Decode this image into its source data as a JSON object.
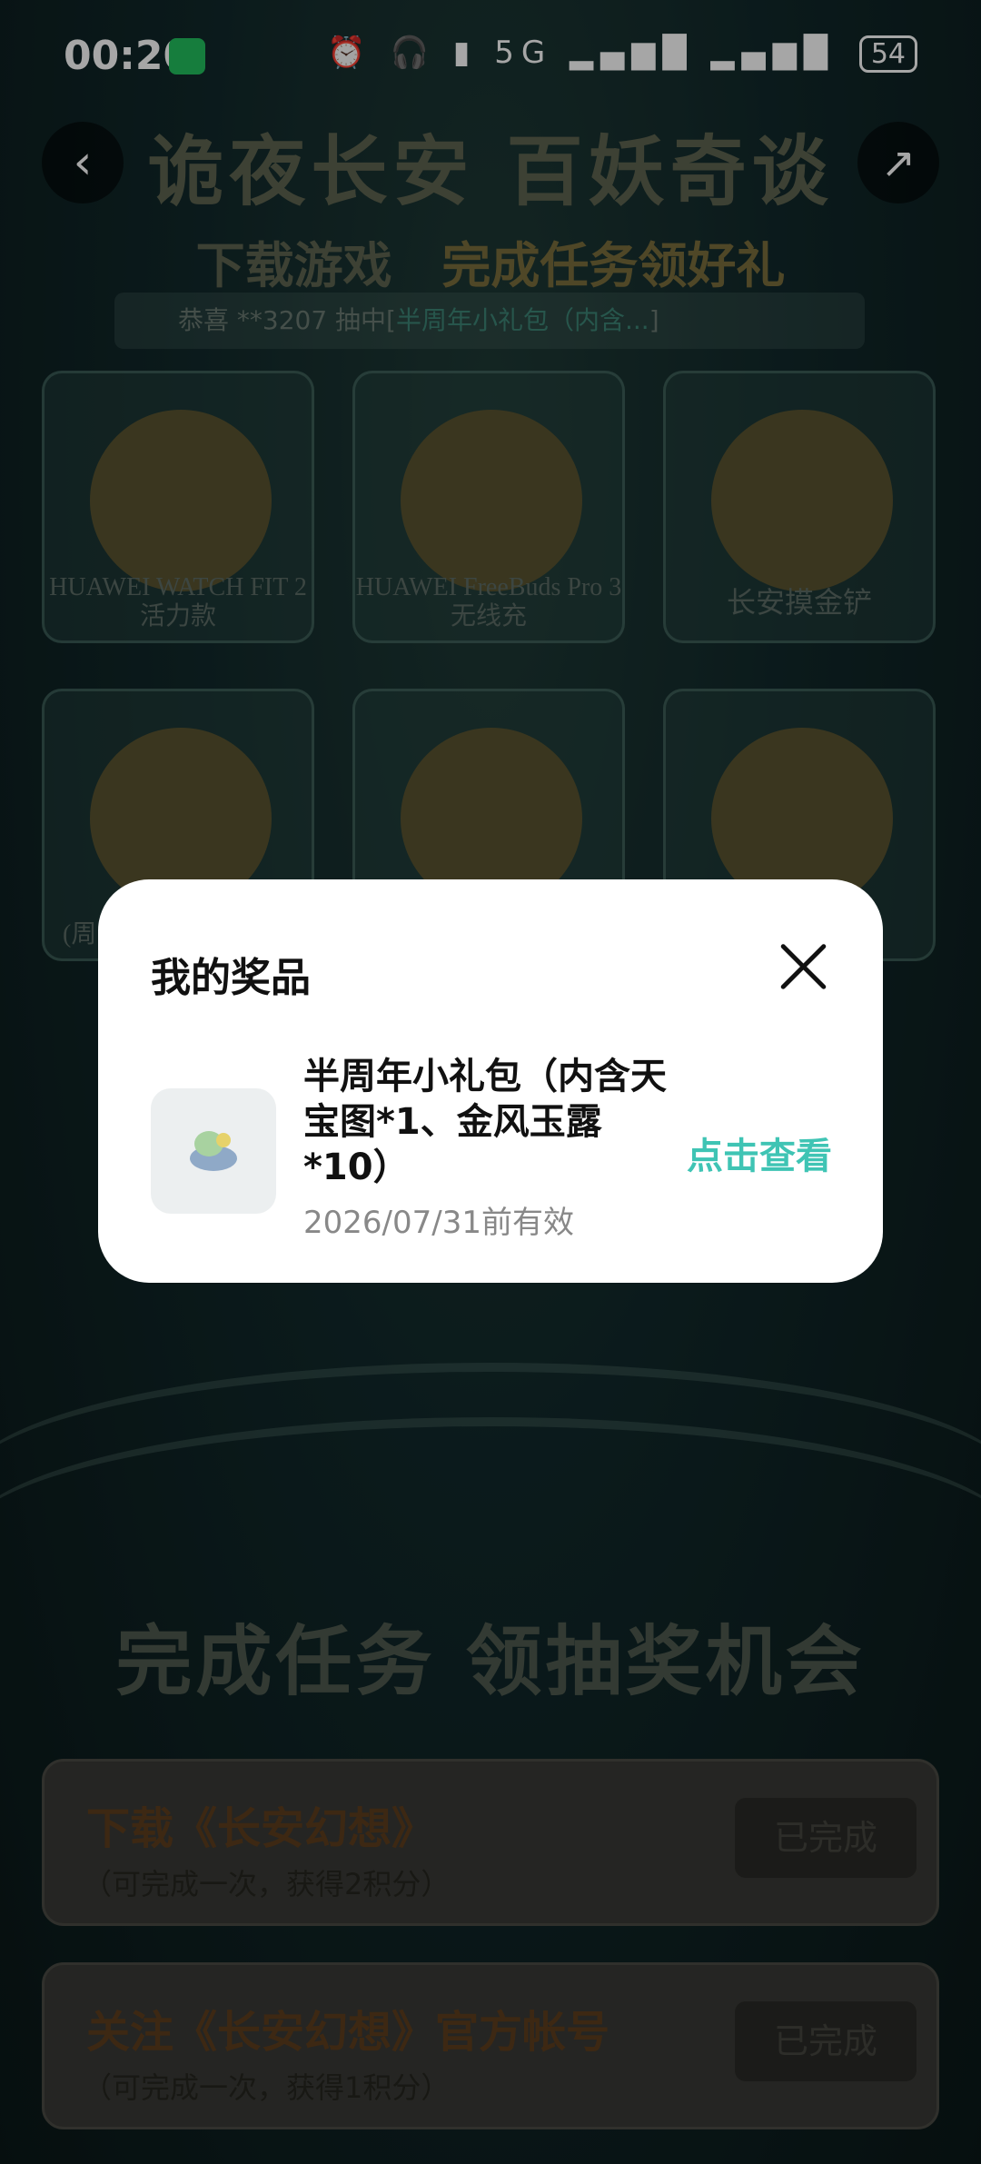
{
  "status_bar": {
    "time": "00:20",
    "icons": "⏰ 🎧 ▮ 5G ▂▄▆█ ▂▄▆█",
    "battery": "54"
  },
  "nav": {
    "back_icon": "back-chevron-icon",
    "share_icon": "share-icon"
  },
  "banner": {
    "title": "诡夜长安 百妖奇谈",
    "subtitle_left": "下载游戏",
    "subtitle_right": "完成任务领好礼",
    "ticker": "恭喜 **3207 抽中[",
    "ticker_highlight": "半周年小礼包（内含...",
    "ticker_end": "]"
  },
  "prizes": [
    {
      "name": "HUAWEI WATCH FIT 2 活力款"
    },
    {
      "name": "HUAWEI FreeBuds Pro 3无线充"
    },
    {
      "name": "长安摸金铲"
    },
    {
      "name": "(周"
    },
    {
      "name": ""
    },
    {
      "name": ""
    }
  ],
  "tasks_section": {
    "title": "完成任务 领抽奖机会"
  },
  "tasks": [
    {
      "title": "下载《长安幻想》",
      "subtitle": "（可完成一次，获得2积分）",
      "button": "已完成"
    },
    {
      "title": "关注《长安幻想》官方帐号",
      "subtitle": "（可完成一次，获得1积分）",
      "button": "已完成"
    }
  ],
  "modal": {
    "title": "我的奖品",
    "item_name": "半周年小礼包（内含天宝图*1、金风玉露*10）",
    "expiry": "2026/07/31前有效",
    "action": "点击查看"
  }
}
